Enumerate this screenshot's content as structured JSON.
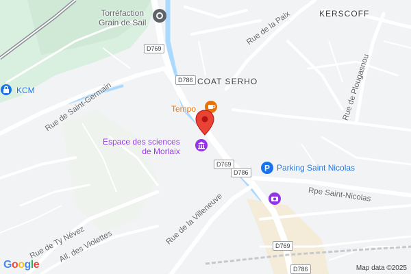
{
  "map": {
    "places": {
      "kerscoff": "KERSCOFF",
      "coat_serho": "COAT SERHO",
      "torrefaction": "Torréfaction\nGrain de Sail",
      "kcm": "KCM",
      "tempo": "Tempo",
      "espace": "Espace des sciences\nde Morlaix",
      "parking": "Parking Saint Nicolas"
    },
    "streets": {
      "rue_paix": "Rue de la Paix",
      "rue_plougasnou": "Rue de Plougasnou",
      "rue_saint_germain": "Rue de Saint-Germain",
      "rue_villeneuve": "Rue de la Villeneuve",
      "rpe_saint_nicolas": "Rpe Saint-Nicolas",
      "rue_ty_nevez": "Rue de Ty Névez",
      "all_violettes": "All. des Violettes"
    },
    "road_shields": [
      "D769",
      "D786",
      "D769",
      "D786",
      "D769",
      "D786"
    ],
    "branding": "Google",
    "attribution": "Map data ©2025",
    "colors": {
      "background": "#f1f3f4",
      "park": "#d6eddc",
      "water": "#aadaff",
      "road": "#ffffff",
      "pin": "#ea4335",
      "poi_blue": "#1a73e8",
      "poi_purple": "#9334e6",
      "poi_orange": "#e8710a"
    }
  }
}
